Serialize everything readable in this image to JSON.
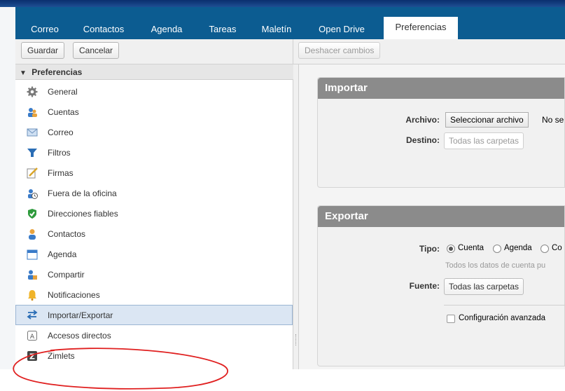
{
  "tabs": [
    {
      "label": "Correo"
    },
    {
      "label": "Contactos"
    },
    {
      "label": "Agenda"
    },
    {
      "label": "Tareas"
    },
    {
      "label": "Maletín"
    },
    {
      "label": "Open Drive"
    },
    {
      "label": "Preferencias",
      "active": true
    }
  ],
  "toolbar": {
    "save_label": "Guardar",
    "cancel_label": "Cancelar",
    "undo_label": "Deshacer cambios"
  },
  "sidebar": {
    "header": "Preferencias",
    "items": [
      {
        "label": "General",
        "icon": "gear-icon"
      },
      {
        "label": "Cuentas",
        "icon": "accounts-icon"
      },
      {
        "label": "Correo",
        "icon": "envelope-icon"
      },
      {
        "label": "Filtros",
        "icon": "filter-icon"
      },
      {
        "label": "Firmas",
        "icon": "signature-icon"
      },
      {
        "label": "Fuera de la oficina",
        "icon": "out-of-office-icon"
      },
      {
        "label": "Direcciones fiables",
        "icon": "shield-check-icon"
      },
      {
        "label": "Contactos",
        "icon": "contact-icon"
      },
      {
        "label": "Agenda",
        "icon": "calendar-icon"
      },
      {
        "label": "Compartir",
        "icon": "share-icon"
      },
      {
        "label": "Notificaciones",
        "icon": "bell-icon"
      },
      {
        "label": "Importar/Exportar",
        "icon": "import-export-icon",
        "selected": true
      },
      {
        "label": "Accesos directos",
        "icon": "shortcut-key-icon"
      },
      {
        "label": "Zimlets",
        "icon": "zimlet-icon"
      }
    ]
  },
  "import": {
    "title": "Importar",
    "file_label": "Archivo:",
    "file_button": "Seleccionar archivo",
    "file_status": "No se",
    "dest_label": "Destino:",
    "dest_value": "Todas las carpetas"
  },
  "export": {
    "title": "Exportar",
    "type_label": "Tipo:",
    "type_options": [
      "Cuenta",
      "Agenda",
      "Co"
    ],
    "type_hint": "Todos los datos de cuenta pu",
    "source_label": "Fuente:",
    "source_value": "Todas las carpetas",
    "advanced_label": "Configuración avanzada"
  },
  "colors": {
    "tabbar": "#0c5c91",
    "panel_header": "#8b8b8b",
    "annotation": "#e02020"
  }
}
